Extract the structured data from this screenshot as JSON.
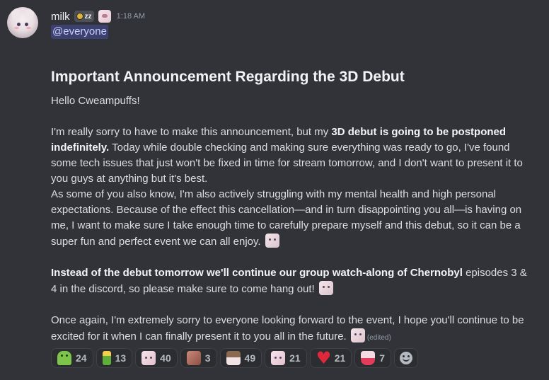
{
  "message": {
    "username": "milk",
    "tag_text": "ᴢz",
    "timestamp": "1:18 AM",
    "mention": "@everyone",
    "heading": "Important Announcement Regarding the 3D Debut",
    "greeting": "Hello Cweampuffs!",
    "p1_a": "I'm really sorry to have to make this announcement, but my ",
    "p1_bold": "3D debut is going to be postponed indefinitely.",
    "p1_b": " Today while double checking and making sure everything was ready to go, I've found some tech issues that just won't be fixed in time for stream tomorrow, and I don't want to present it to you guys at anything but it's best.",
    "p2": "As some of you also know, I'm also actively struggling with my mental health and high personal expectations. Because of the effect this cancellation—and in turn disappointing you all—is having on me, I want to make sure I take enough time to carefully prepare myself and this debut, so it can be a super fun and perfect event we can all enjoy.",
    "p3_bold": "Instead of the debut tomorrow we'll continue our group watch-along of Chernobyl",
    "p3_rest": " episodes 3 & 4 in the discord, so please make sure to come hang out!",
    "p4": "Once again, I'm extremely sorry to everyone looking forward to the event, I hope you'll continue to be excited for it when I can finally present it to you all in the future.",
    "edited_label": "(edited)"
  },
  "reactions": [
    {
      "icon": "android-emoji-icon",
      "count": "24"
    },
    {
      "icon": "bottle-emoji-icon",
      "count": "13"
    },
    {
      "icon": "pink-character-emoji-icon",
      "count": "40"
    },
    {
      "icon": "brown-character-emoji-icon",
      "count": "3"
    },
    {
      "icon": "hat-character-emoji-icon",
      "count": "49"
    },
    {
      "icon": "pink-face-emoji-icon",
      "count": "21"
    },
    {
      "icon": "red-heart-emoji-icon",
      "count": "21"
    },
    {
      "icon": "cake-emoji-icon",
      "count": "7"
    }
  ],
  "colors": {
    "background": "#323339",
    "mention_bg": "#3c4270",
    "reaction_bg": "#2b2d31",
    "heart": "#e0283b"
  }
}
